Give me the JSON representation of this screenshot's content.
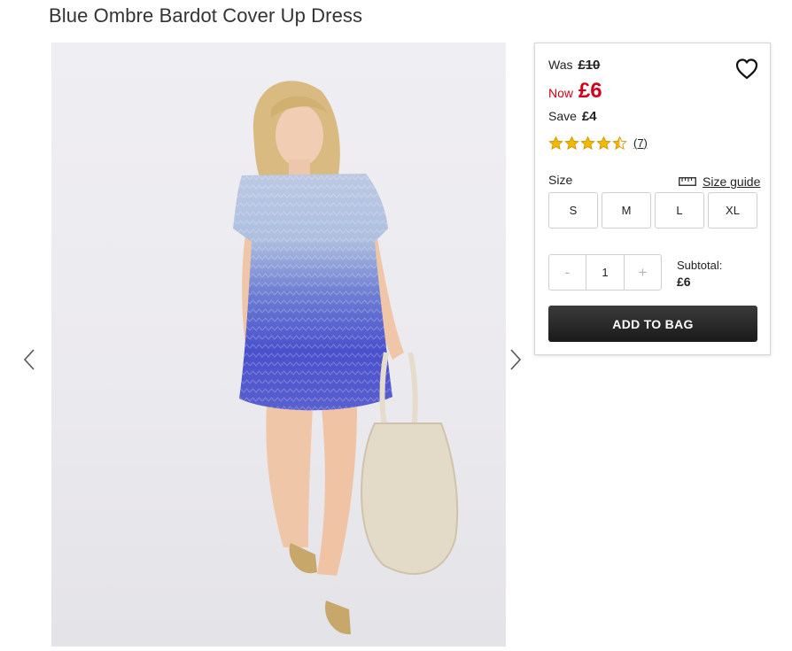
{
  "product": {
    "title": "Blue Ombre Bardot Cover Up Dress"
  },
  "gallery": {
    "prev_icon": "chevron-left-icon",
    "next_icon": "chevron-right-icon"
  },
  "pricing": {
    "was_label": "Was",
    "was_price": "£10",
    "now_label": "Now",
    "now_price": "£6",
    "save_label": "Save",
    "save_amount": "£4",
    "accent_color": "#d0021b"
  },
  "rating": {
    "stars": 4.5,
    "max": 5,
    "review_count": "(7)",
    "star_color": "#f5b700"
  },
  "size": {
    "label": "Size",
    "guide_label": "Size guide",
    "guide_icon": "ruler-icon",
    "options": [
      "S",
      "M",
      "L",
      "XL"
    ]
  },
  "quantity": {
    "minus": "-",
    "value": "1",
    "plus": "+"
  },
  "subtotal": {
    "label": "Subtotal:",
    "value": "£6"
  },
  "actions": {
    "add_to_bag": "ADD TO BAG",
    "wishlist_icon": "heart-icon"
  }
}
